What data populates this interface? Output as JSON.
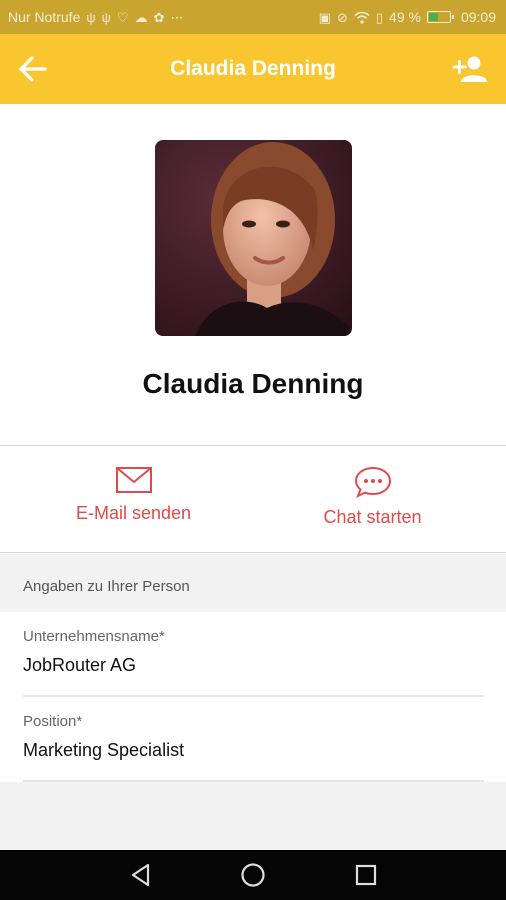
{
  "status_bar": {
    "carrier": "Nur Notrufe",
    "battery": "49 %",
    "battery_level": 0.49,
    "time": "09:09",
    "icons": [
      "usb-icon",
      "usb-icon",
      "heart-icon",
      "cloud-icon",
      "settings-icon",
      "more-icon",
      "nfc-icon",
      "mute-icon",
      "wifi-icon",
      "sim-icon",
      "battery-icon"
    ]
  },
  "app_bar": {
    "title": "Claudia Denning",
    "back_icon": "arrow-left-icon",
    "add_icon": "add-person-icon"
  },
  "profile": {
    "name": "Claudia Denning"
  },
  "actions": {
    "email_label": "E-Mail senden",
    "chat_label": "Chat starten",
    "accent_color": "#e04a4a"
  },
  "details": {
    "section_title": "Angaben zu Ihrer Person",
    "fields": [
      {
        "label": "Unternehmensname*",
        "value": "JobRouter AG"
      },
      {
        "label": "Position*",
        "value": "Marketing Specialist"
      }
    ]
  },
  "colors": {
    "app_bar": "#f9c630",
    "status_bar": "#c9a530"
  }
}
